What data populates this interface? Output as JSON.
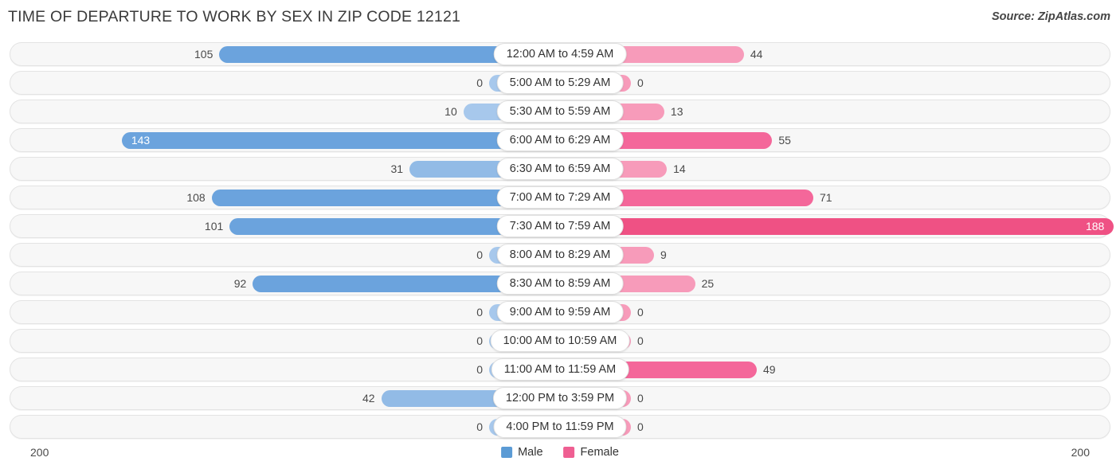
{
  "header": {
    "title": "TIME OF DEPARTURE TO WORK BY SEX IN ZIP CODE 12121",
    "source": "Source: ZipAtlas.com"
  },
  "axis": {
    "left_label": "200",
    "right_label": "200",
    "max": 200
  },
  "legend": {
    "items": [
      {
        "label": "Male",
        "color": "#5b9bd5"
      },
      {
        "label": "Female",
        "color": "#ef5f92"
      }
    ]
  },
  "colors": {
    "male_strong": "#6ba3dd",
    "male_light": "#a7c8ec",
    "female_light": "#f79bba",
    "female_mid": "#f4679a",
    "female_strong": "#ef5184",
    "track_bg": "#f7f7f7",
    "track_border": "#e3e3e3",
    "pill_bg": "#ffffff",
    "text": "#4a4a4a"
  },
  "chart_data": {
    "type": "bar",
    "subtype": "diverging-bidirectional",
    "title": "TIME OF DEPARTURE TO WORK BY SEX IN ZIP CODE 12121",
    "xlabel": "",
    "ylabel": "",
    "xlim": [
      200,
      200
    ],
    "grid": false,
    "legend_position": "bottom-center",
    "categories": [
      "12:00 AM to 4:59 AM",
      "5:00 AM to 5:29 AM",
      "5:30 AM to 5:59 AM",
      "6:00 AM to 6:29 AM",
      "6:30 AM to 6:59 AM",
      "7:00 AM to 7:29 AM",
      "7:30 AM to 7:59 AM",
      "8:00 AM to 8:29 AM",
      "8:30 AM to 8:59 AM",
      "9:00 AM to 9:59 AM",
      "10:00 AM to 10:59 AM",
      "11:00 AM to 11:59 AM",
      "12:00 PM to 3:59 PM",
      "4:00 PM to 11:59 PM"
    ],
    "series": [
      {
        "name": "Male",
        "direction": "left",
        "values": [
          105,
          0,
          10,
          143,
          31,
          108,
          101,
          0,
          92,
          0,
          0,
          0,
          42,
          0
        ]
      },
      {
        "name": "Female",
        "direction": "right",
        "values": [
          44,
          0,
          13,
          55,
          14,
          71,
          188,
          9,
          25,
          0,
          0,
          49,
          0,
          0
        ]
      }
    ]
  },
  "rows": [
    {
      "category": "12:00 AM to 4:59 AM",
      "male": "105",
      "female": "44"
    },
    {
      "category": "5:00 AM to 5:29 AM",
      "male": "0",
      "female": "0"
    },
    {
      "category": "5:30 AM to 5:59 AM",
      "male": "10",
      "female": "13"
    },
    {
      "category": "6:00 AM to 6:29 AM",
      "male": "143",
      "female": "55"
    },
    {
      "category": "6:30 AM to 6:59 AM",
      "male": "31",
      "female": "14"
    },
    {
      "category": "7:00 AM to 7:29 AM",
      "male": "108",
      "female": "71"
    },
    {
      "category": "7:30 AM to 7:59 AM",
      "male": "101",
      "female": "188"
    },
    {
      "category": "8:00 AM to 8:29 AM",
      "male": "0",
      "female": "9"
    },
    {
      "category": "8:30 AM to 8:59 AM",
      "male": "92",
      "female": "25"
    },
    {
      "category": "9:00 AM to 9:59 AM",
      "male": "0",
      "female": "0"
    },
    {
      "category": "10:00 AM to 10:59 AM",
      "male": "0",
      "female": "0"
    },
    {
      "category": "11:00 AM to 11:59 AM",
      "male": "0",
      "female": "49"
    },
    {
      "category": "12:00 PM to 3:59 PM",
      "male": "42",
      "female": "0"
    },
    {
      "category": "4:00 PM to 11:59 PM",
      "male": "0",
      "female": "0"
    }
  ]
}
